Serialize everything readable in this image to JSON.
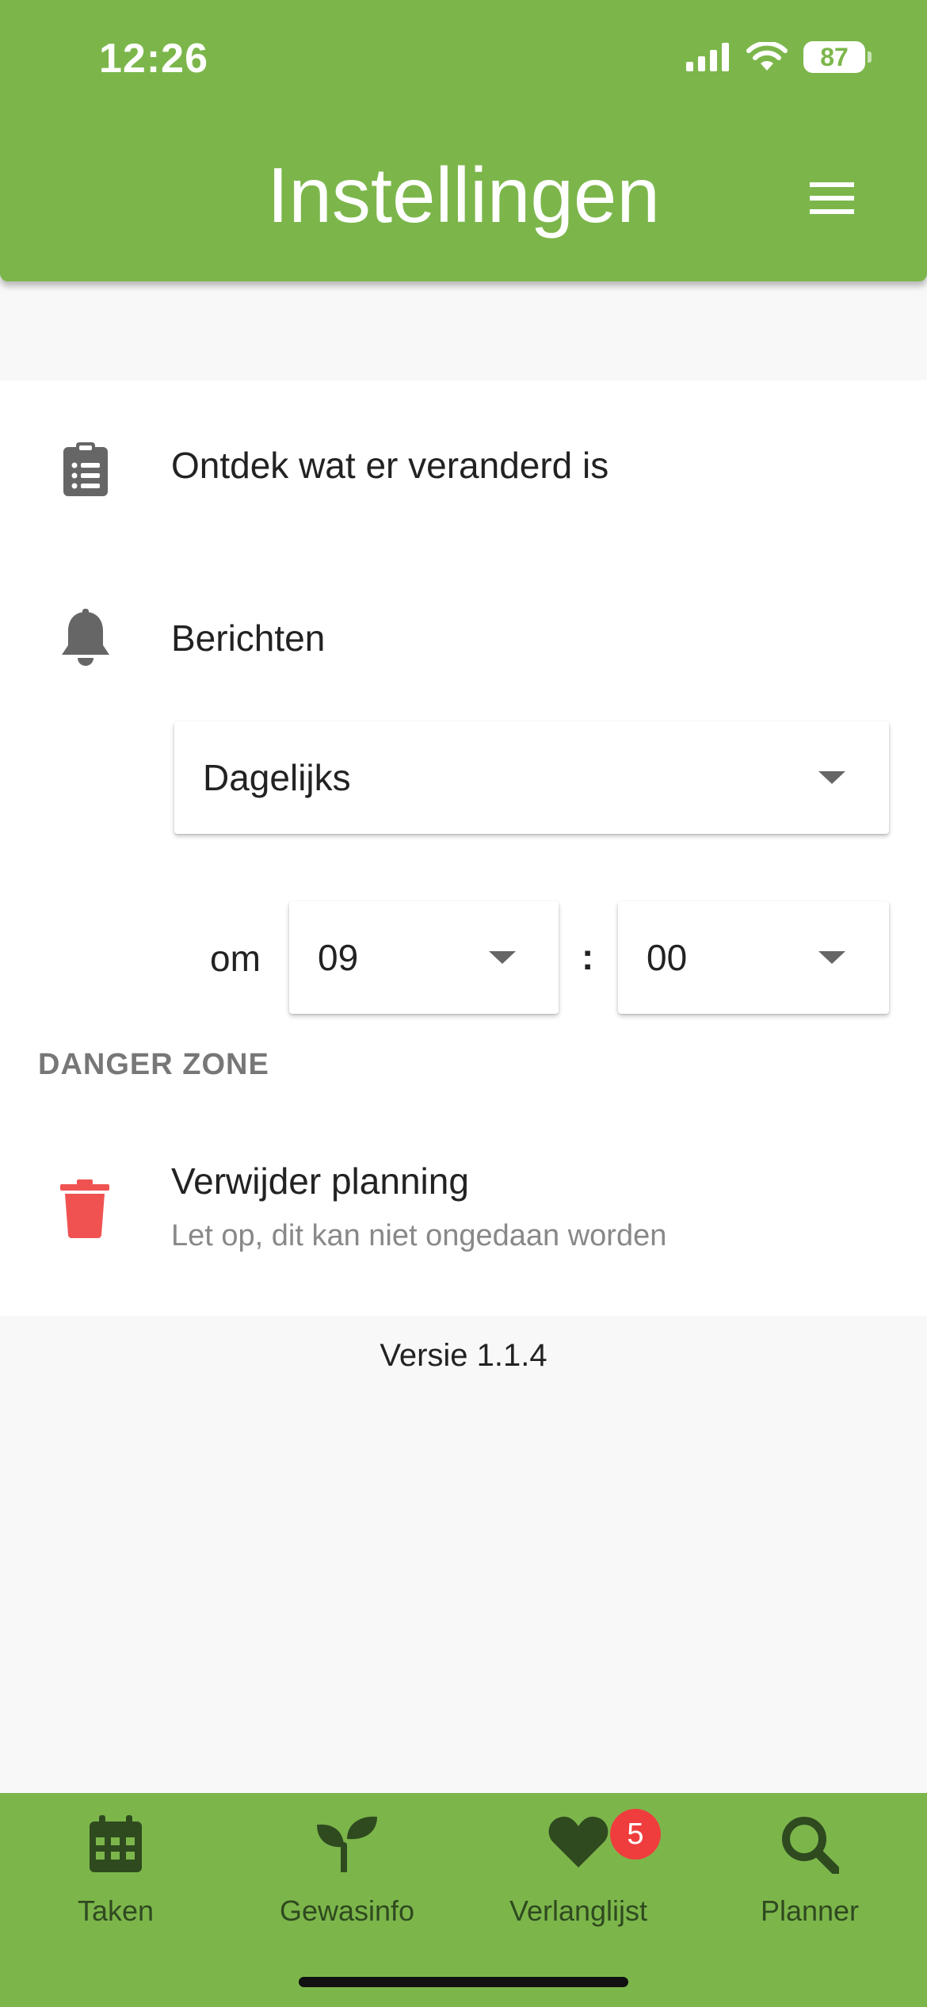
{
  "status_bar": {
    "time": "12:26",
    "battery": "87"
  },
  "header": {
    "title": "Instellingen"
  },
  "settings": {
    "changelog_label": "Ontdek wat er veranderd is",
    "notifications_label": "Berichten",
    "frequency": {
      "selected": "Dagelijks"
    },
    "time": {
      "prefix": "om",
      "hour": "09",
      "separator": ":",
      "minute": "00"
    }
  },
  "danger_zone": {
    "label": "DANGER ZONE",
    "delete_title": "Verwijder planning",
    "delete_subtitle": "Let op, dit kan niet ongedaan worden"
  },
  "version": "Versie 1.1.4",
  "bottom_nav": {
    "items": [
      {
        "label": "Taken",
        "icon": "calendar-icon"
      },
      {
        "label": "Gewasinfo",
        "icon": "sprout-icon"
      },
      {
        "label": "Verlanglijst",
        "icon": "heart-icon",
        "badge": "5"
      },
      {
        "label": "Planner",
        "icon": "search-icon"
      }
    ]
  },
  "colors": {
    "brand_green": "#7cb64b",
    "nav_text": "#2f4a1f",
    "danger_red": "#f05252",
    "badge_red": "#ef3d3d"
  }
}
